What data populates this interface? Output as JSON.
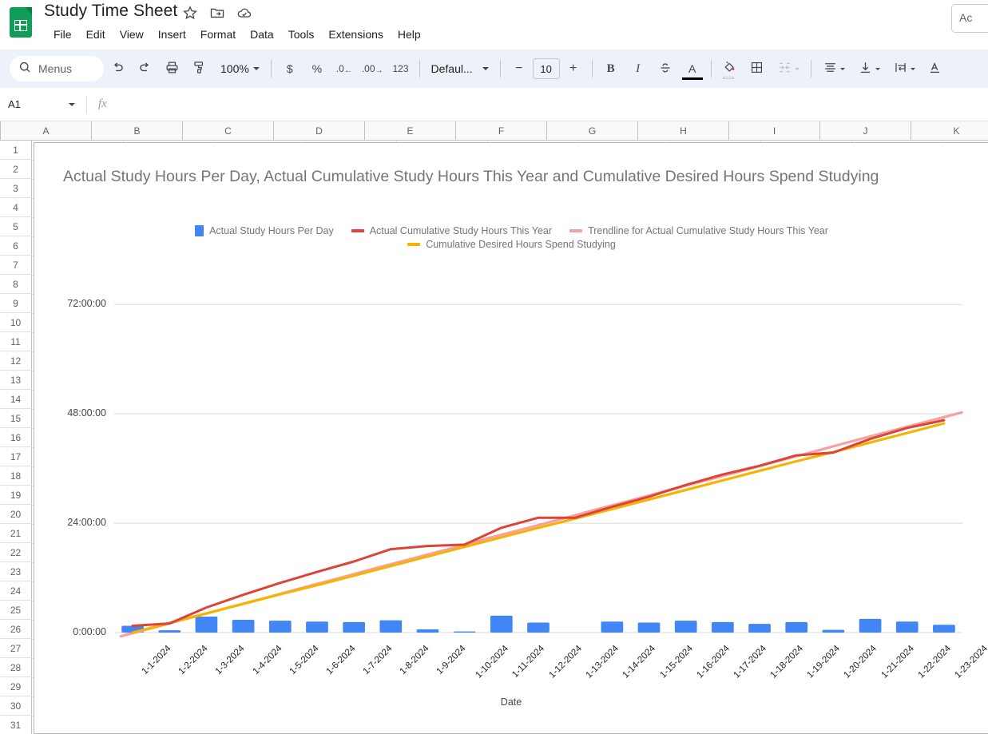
{
  "app": {
    "doc_title": "Study Time Sheet",
    "doc_icon": "sheets-icon",
    "title_icons": [
      "star-icon",
      "move-to-folder-icon",
      "cloud-saved-icon"
    ],
    "account_button": "Ac"
  },
  "menubar": {
    "items": [
      {
        "label": "File"
      },
      {
        "label": "Edit"
      },
      {
        "label": "View"
      },
      {
        "label": "Insert"
      },
      {
        "label": "Format"
      },
      {
        "label": "Data"
      },
      {
        "label": "Tools"
      },
      {
        "label": "Extensions"
      },
      {
        "label": "Help"
      }
    ]
  },
  "toolbar": {
    "search_label": "Menus",
    "search_icon": "search-icon",
    "undo_icon": "undo-icon",
    "redo_icon": "redo-icon",
    "print_icon": "print-icon",
    "paint_format_icon": "paint-format-icon",
    "zoom_value": "100%",
    "currency_label": "$",
    "percent_label": "%",
    "decrease_decimal_label": ".0",
    "increase_decimal_label": ".00",
    "more_formats_label": "123",
    "font_name": "Defaul...",
    "font_decrease_label": "−",
    "font_size": "10",
    "font_increase_label": "+",
    "bold_label": "B",
    "italic_label": "I",
    "strikethrough_icon": "strikethrough-icon",
    "text_color_label": "A",
    "fill_color_icon": "fill-color-icon",
    "borders_icon": "borders-icon",
    "merge_cells_icon": "merge-cells-icon",
    "horizontal_align_icon": "horizontal-align-icon",
    "vertical_align_icon": "vertical-align-icon",
    "text_wrap_icon": "text-wrapping-icon",
    "text_rotation_label": "A"
  },
  "formula_bar": {
    "name_box": "A1",
    "fx_label": "fx",
    "formula_value": ""
  },
  "grid": {
    "columns": [
      "A",
      "B",
      "C",
      "D",
      "E",
      "F",
      "G",
      "H",
      "I",
      "J",
      "K"
    ],
    "rows": [
      "1",
      "2",
      "3",
      "4",
      "5",
      "6",
      "7",
      "8",
      "9",
      "10",
      "11",
      "12",
      "13",
      "14",
      "15",
      "16",
      "17",
      "18",
      "19",
      "20",
      "21",
      "22",
      "23",
      "24",
      "25",
      "26",
      "27",
      "28",
      "29",
      "30",
      "31"
    ]
  },
  "chart_data": {
    "type": "bar",
    "title": "Actual Study Hours Per Day, Actual Cumulative Study Hours This Year and Cumulative Desired Hours Spend Studying",
    "xlabel": "Date",
    "ylabel": "",
    "grid": true,
    "legend_position": "top",
    "ylim": [
      0,
      78
    ],
    "ytick_values": [
      0,
      24,
      48,
      72
    ],
    "ytick_labels": [
      "0:00:00",
      "24:00:00",
      "48:00:00",
      "72:00:00"
    ],
    "categories": [
      "1-1-2024",
      "1-2-2024",
      "1-3-2024",
      "1-4-2024",
      "1-5-2024",
      "1-6-2024",
      "1-7-2024",
      "1-8-2024",
      "1-9-2024",
      "1-10-2024",
      "1-11-2024",
      "1-12-2024",
      "1-13-2024",
      "1-14-2024",
      "1-15-2024",
      "1-16-2024",
      "1-17-2024",
      "1-18-2024",
      "1-19-2024",
      "1-20-2024",
      "1-21-2024",
      "1-22-2024",
      "1-23-2024"
    ],
    "series": [
      {
        "name": "Actual Study Hours Per Day",
        "type": "bar",
        "color": "#4285f4",
        "values": [
          1.5,
          0.5,
          3.5,
          2.8,
          2.6,
          2.4,
          2.3,
          2.7,
          0.7,
          0.25,
          3.7,
          2.2,
          0.0,
          2.4,
          2.2,
          2.6,
          2.3,
          1.9,
          2.3,
          0.6,
          3.0,
          2.4,
          1.7
        ]
      },
      {
        "name": "Actual Cumulative Study Hours This Year",
        "type": "line",
        "color": "#db4437",
        "values": [
          1.5,
          2.0,
          5.5,
          8.3,
          10.9,
          13.3,
          15.6,
          18.3,
          19.0,
          19.3,
          23.0,
          25.2,
          25.2,
          27.6,
          29.8,
          32.4,
          34.7,
          36.6,
          38.9,
          39.5,
          42.5,
          44.9,
          46.6
        ]
      },
      {
        "name": "Trendline for Actual Cumulative Study Hours This Year",
        "type": "line",
        "color": "#f7a0a0",
        "values": [
          -0.8,
          1.3,
          3.5,
          5.6,
          7.7,
          9.9,
          12.0,
          14.2,
          16.3,
          18.4,
          20.6,
          22.7,
          24.8,
          27.0,
          29.1,
          31.3,
          33.4,
          35.5,
          37.7,
          39.8,
          42.0,
          44.1,
          46.2,
          48.3
        ]
      },
      {
        "name": "Cumulative Desired Hours Spend Studying",
        "type": "line",
        "color": "#f4b400",
        "values": [
          0.0,
          2.1,
          4.2,
          6.3,
          8.4,
          10.4,
          12.5,
          14.6,
          16.7,
          18.8,
          20.9,
          23.0,
          25.0,
          27.1,
          29.2,
          31.3,
          33.4,
          35.5,
          37.6,
          39.6,
          41.7,
          43.8,
          45.9
        ]
      }
    ]
  }
}
